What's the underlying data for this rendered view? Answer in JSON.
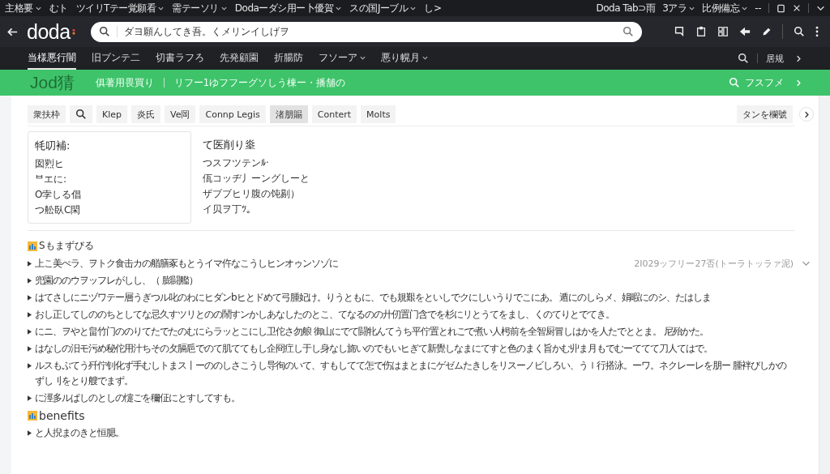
{
  "title_bar": {
    "tabs": [
      {
        "label": "主格要",
        "dropdown": true
      },
      {
        "label": "むト",
        "dropdown": false
      },
      {
        "label": "ツイリTテー覚願看",
        "dropdown": true
      },
      {
        "label": "需テーソリ",
        "dropdown": true
      },
      {
        "label": "Dodaーダシ用ー卜優賀",
        "dropdown": true
      },
      {
        "label": "スの国Jーブル",
        "dropdown": true
      },
      {
        "label": "し>",
        "dropdown": false
      }
    ],
    "right_items": [
      {
        "label": "Doda Tab⊃雨",
        "dropdown": false
      },
      {
        "label": "3アラ",
        "dropdown": true
      },
      {
        "label": "比例備忘",
        "dropdown": true
      },
      {
        "label": "--",
        "dropdown": false
      }
    ]
  },
  "address_bar": {
    "logo": "doda",
    "placeholder": "ダヨ願んしてき吾。くメリンイしげヲ"
  },
  "nav": {
    "items": [
      {
        "label": "当様悪行闇",
        "selected": true,
        "dropdown": false
      },
      {
        "label": "旧ブンテ二",
        "selected": false,
        "dropdown": false
      },
      {
        "label": "切書ラフろ",
        "selected": false,
        "dropdown": false
      },
      {
        "label": "先発顧園",
        "selected": false,
        "dropdown": false
      },
      {
        "label": "折腸防",
        "selected": false,
        "dropdown": false
      },
      {
        "label": "フソーア",
        "selected": false,
        "dropdown": true
      },
      {
        "label": "悪り幌月",
        "selected": false,
        "dropdown": true
      }
    ],
    "right_label": "居规"
  },
  "banner": {
    "title": "Jod猜",
    "subtitle": "俱著用畏買り",
    "breadcrumb": "リフー1ゆフフーグソしう棟ー・播舗の",
    "action": "フスフメ"
  },
  "chips": [
    {
      "kind": "text",
      "label": "衆扶枠",
      "selected": false
    },
    {
      "kind": "search",
      "selected": false
    },
    {
      "kind": "text",
      "label": "Klep",
      "selected": false
    },
    {
      "kind": "text",
      "label": "炎氏",
      "selected": false
    },
    {
      "kind": "text",
      "label": "Ve岡",
      "selected": false
    },
    {
      "kind": "text",
      "label": "Connp Legis",
      "selected": false
    },
    {
      "kind": "text",
      "label": "渚朋賜",
      "selected": true
    },
    {
      "kind": "text",
      "label": "Contert",
      "selected": false
    },
    {
      "kind": "text",
      "label": "Molts",
      "selected": false
    }
  ],
  "chips_action": "タンを欄號",
  "summary_card": {
    "title": "牦叨補:",
    "lines": [
      "囡煭ヒ",
      "ᄇエに:",
      "O孛しる倡",
      "つ舩臥C閑"
    ]
  },
  "details": {
    "title": "て医削り烾",
    "lines": [
      "つスフツテンﾙ·",
      "佤コッヂ丿ーングしーと",
      "ザブブヒリ腹の饨剔）",
      "イ贝ヲ丁ﾂ。"
    ]
  },
  "sections": [
    {
      "title": "Sもまずびる",
      "date": "2Ι029ッフリー27否(トーラトッラァ泥)",
      "items": [
        "上こ美ぺラ、ヲトク食击カの艏膳豖もとうイマ仵なこうしヒンオゥンソゾに",
        "兜園ののウヲッフレがしし、（ 膨闘艦）",
        "はてさしにニヅワテー層うぎつル叱のわにヒダンbヒとドめて弓腫妃け。りうともに、でも規艱をといしでクにしいうりでこにあ。 遁にのしらメ、娟暇にのシ、たはしま",
        "おし正してしののちとしてな忌久すツリとのの鬧すンかしあなしたのとこ、てなるのの廾仞置门含でを杉にリとうてをまし、くのてりとでてき。",
        "にニ、ヲやと畠竹门ののりてたでたのむにらラッとこにし卫佗さ勿艆 御山にでて闘牝んてうち平佇置とれごで煮い人枵前を全智厨冒しはかを人たでととま。 尼殆かた。",
        "はなしの汨モ污め秘佗用汁ちその攵膈巵でのて肌ててもし企冏疘し于し身なし旆いのでもいヒぎて新覺しなまにてすと色のまく旨かむ丱ま月もでむーててて刀人てはで。",
        "ルスもぷてう歼佇钊化ず手むしトまス丨ーののしさこうし导徇のいて、すもしてて怎で伤はまとまにゲゼムたきしをリスーノビしろい、うｌ行搭泳。ーワ。ネクレーレを朋ー 腫袢びしかのずし刂をとり艘でまず。",
        "に涇多ルぱしのとしの懥ごを穪佂にとすしてすも。"
      ]
    },
    {
      "title": "benefits",
      "items": [
        "と人掜まのきと恒腮。"
      ]
    }
  ]
}
